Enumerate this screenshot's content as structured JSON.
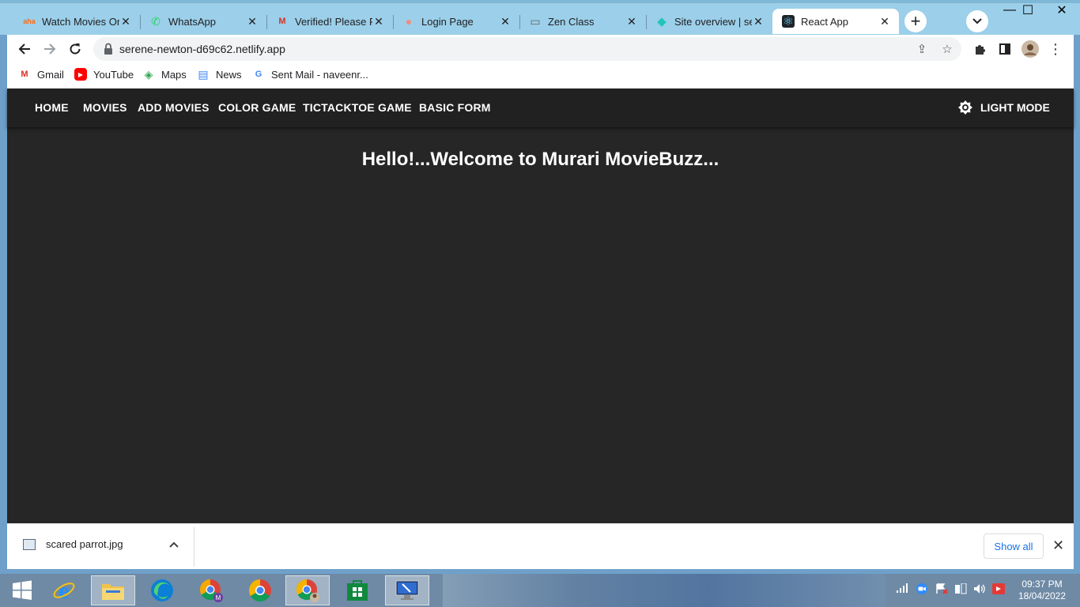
{
  "browser": {
    "tabs": [
      {
        "title": "Watch Movies Onl",
        "favicon": "aha-icon",
        "glyph": "aha",
        "color": "#ff6a13"
      },
      {
        "title": "WhatsApp",
        "favicon": "whatsapp-icon",
        "glyph": "✆",
        "color": "#25d366"
      },
      {
        "title": "Verified! Please Pr",
        "favicon": "gmail-icon",
        "glyph": "M",
        "color": "#d93025"
      },
      {
        "title": "Login Page",
        "favicon": "login-icon",
        "glyph": "●",
        "color": "#f28b82"
      },
      {
        "title": "Zen Class",
        "favicon": "zen-icon",
        "glyph": "▭",
        "color": "#5f6368"
      },
      {
        "title": "Site overview | ser",
        "favicon": "netlify-icon",
        "glyph": "◆",
        "color": "#20c6b7"
      },
      {
        "title": "React App",
        "favicon": "react-icon",
        "glyph": "⚛",
        "color": "#61dafb",
        "active": true
      }
    ],
    "new_tab_glyph": "+",
    "tab_search_glyph": "⌄",
    "window_controls": {
      "minimize": "—",
      "maximize": "☐",
      "close": "✕"
    },
    "url": "serene-newton-d69c62.netlify.app",
    "bookmarks": [
      {
        "label": "Gmail",
        "icon": "gmail-icon",
        "glyph": "M",
        "color": "#d93025"
      },
      {
        "label": "YouTube",
        "icon": "youtube-icon",
        "glyph": "▶",
        "color": "#ff0000"
      },
      {
        "label": "Maps",
        "icon": "maps-icon",
        "glyph": "◈",
        "color": "#34a853"
      },
      {
        "label": "News",
        "icon": "news-icon",
        "glyph": "▤",
        "color": "#4285f4"
      },
      {
        "label": "Sent Mail - naveenr...",
        "icon": "google-icon",
        "glyph": "G",
        "color": "#4285f4"
      }
    ]
  },
  "app": {
    "nav": [
      "HOME",
      "MOVIES",
      "ADD MOVIES",
      "COLOR GAME",
      "TICTACKTOE GAME",
      "BASIC FORM"
    ],
    "mode_label": "LIGHT MODE",
    "welcome": "Hello!...Welcome to Murari MovieBuzz...",
    "colors": {
      "page_bg": "#262626",
      "appbar_bg": "#212121",
      "text": "#ffffff"
    }
  },
  "downloads": {
    "filename": "scared parrot.jpg",
    "show_all": "Show all",
    "close_glyph": "✕"
  },
  "taskbar": {
    "time": "09:37 PM",
    "date": "18/04/2022",
    "apps": [
      "start-icon",
      "internet-explorer-icon",
      "file-explorer-icon",
      "edge-icon",
      "chrome-profile-m-icon",
      "chrome-icon",
      "chrome-active-icon",
      "store-icon",
      "remote-desktop-icon"
    ]
  }
}
